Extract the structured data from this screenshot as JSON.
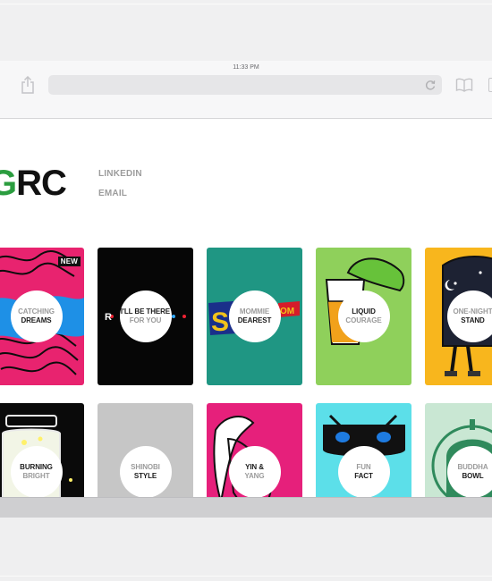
{
  "status_bar": {
    "time": "11:33 PM"
  },
  "site": {
    "logo_accent": "G",
    "logo_rest": "RC",
    "nav": [
      {
        "label": "LINKEDIN"
      },
      {
        "label": "EMAIL"
      }
    ]
  },
  "badge_new": "NEW",
  "cards": [
    {
      "line1": "CATCHING",
      "line2": "DREAMS",
      "bg": "#e8236f"
    },
    {
      "line1": "I'LL BE THERE",
      "line2": "FOR YOU",
      "bg": "#060606"
    },
    {
      "line1": "MOMMIE",
      "line2": "DEAREST",
      "bg": "#1f9683"
    },
    {
      "line1": "LIQUID",
      "line2": "COURAGE",
      "bg": "#8fd05b"
    },
    {
      "line1": "ONE-NIGHT",
      "line2": "STAND",
      "bg": "#f8b61d"
    },
    {
      "line1": "BURNING",
      "line2": "BRIGHT",
      "bg": "#0a0a0a"
    },
    {
      "line1": "SHINOBI",
      "line2": "STYLE",
      "bg": "#c6c6c6"
    },
    {
      "line1": "YIN &",
      "line2": "YANG",
      "bg": "#e6207b"
    },
    {
      "line1": "FUN",
      "line2": "FACT",
      "bg": "#5cdfe9"
    },
    {
      "line1": "BUDDHA",
      "line2": "BOWL",
      "bg": "#c9e7d3"
    }
  ]
}
